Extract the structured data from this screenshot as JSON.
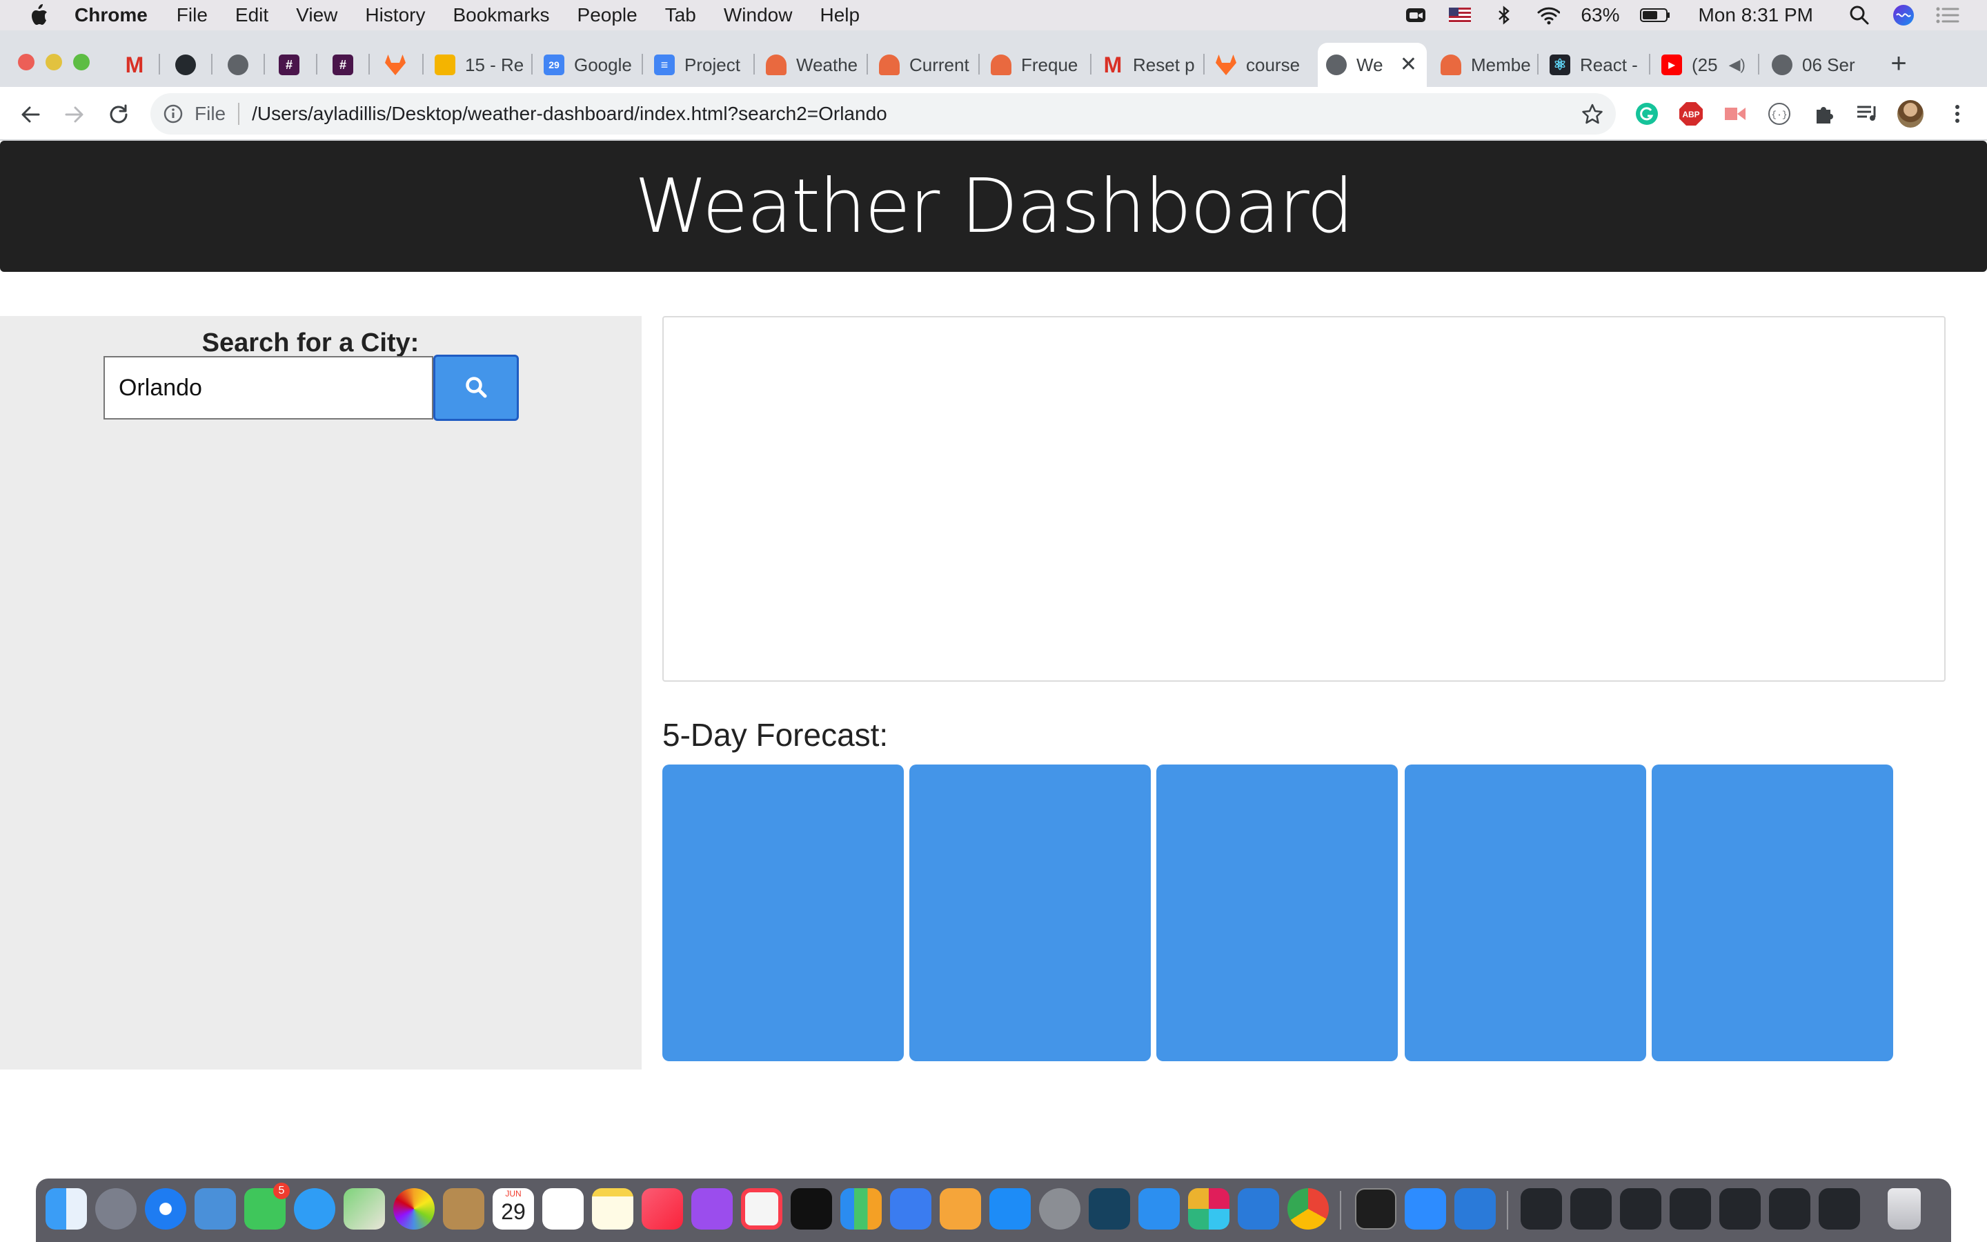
{
  "menubar": {
    "app": "Chrome",
    "items": [
      "File",
      "Edit",
      "View",
      "History",
      "Bookmarks",
      "People",
      "Tab",
      "Window",
      "Help"
    ],
    "battery": "63%",
    "clock": "Mon 8:31 PM"
  },
  "tabs": [
    {
      "label": "",
      "icon": "gmail-icon"
    },
    {
      "label": "",
      "icon": "github-icon"
    },
    {
      "label": "",
      "icon": "globe-icon"
    },
    {
      "label": "",
      "icon": "slack-icon"
    },
    {
      "label": "",
      "icon": "slack-icon"
    },
    {
      "label": "",
      "icon": "gitlab-icon"
    },
    {
      "label": "15 - Re",
      "icon": "slides-icon"
    },
    {
      "label": "Google",
      "icon": "calendar-icon"
    },
    {
      "label": "Project",
      "icon": "docs-icon"
    },
    {
      "label": "Weathe",
      "icon": "weather-icon"
    },
    {
      "label": "Current",
      "icon": "weather-icon"
    },
    {
      "label": "Freque",
      "icon": "weather-icon"
    },
    {
      "label": "Reset p",
      "icon": "gmail-icon"
    },
    {
      "label": "course",
      "icon": "gitlab-icon"
    },
    {
      "label": "We",
      "icon": "globe-icon",
      "active": true
    },
    {
      "label": "Membe",
      "icon": "weather-icon"
    },
    {
      "label": "React -",
      "icon": "react-icon"
    },
    {
      "label": "(25",
      "icon": "youtube-icon"
    },
    {
      "label": "06 Ser",
      "icon": "globe-icon"
    }
  ],
  "omnibox": {
    "scheme": "File",
    "url": "/Users/ayladillis/Desktop/weather-dashboard/index.html?search2=Orlando"
  },
  "page": {
    "title": "Weather Dashboard",
    "search_label": "Search for a City:",
    "search_value": "Orlando",
    "forecast_title": "5-Day Forecast:"
  },
  "dock": {
    "calendar_month": "JUN",
    "calendar_day": "29",
    "facetime_badge": "5"
  },
  "colors": {
    "header_bg": "#212121",
    "card_blue": "#4495e8",
    "button_blue": "#4395ea",
    "sidebar_bg": "#ececec"
  }
}
